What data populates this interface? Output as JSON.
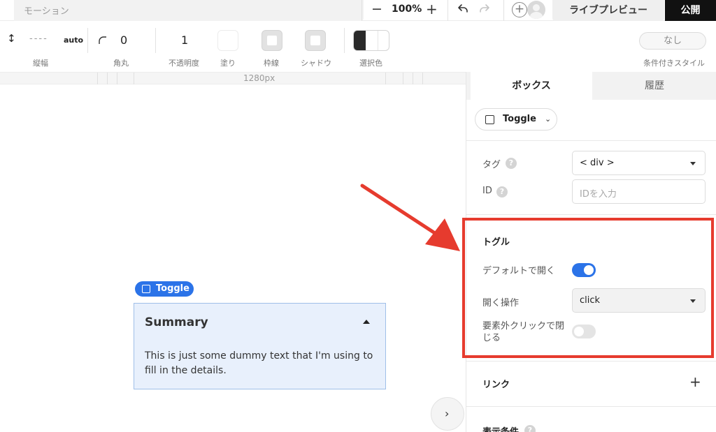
{
  "topbar": {
    "mode_label": "モーション",
    "zoom_minus": "−",
    "zoom_level": "100%",
    "zoom_plus": "+",
    "add_symbol": "+",
    "live_preview_label": "ライブプレビュー",
    "publish_label": "公開"
  },
  "toolbar": {
    "height_icon": "↕",
    "height_value": "----",
    "height_mode": "auto",
    "height_label": "縦幅",
    "radius_value": "0",
    "radius_label": "角丸",
    "opacity_value": "1",
    "opacity_label": "不透明度",
    "fill_label": "塗り",
    "border_label": "枠線",
    "shadow_label": "シャドウ",
    "selection_color_label": "選択色",
    "condition_style_value": "なし",
    "condition_style_label": "条件付きスタイル"
  },
  "ruler": {
    "width_label": "1280px"
  },
  "canvas": {
    "element_badge": "Toggle",
    "toggle_summary": "Summary",
    "toggle_details": "This is just some dummy text that I'm using to fill in the details.",
    "expand_symbol": "›"
  },
  "panel": {
    "tabs": [
      {
        "label": "ボックス",
        "active": true
      },
      {
        "label": "履歴",
        "active": false
      }
    ],
    "element_selector": "Toggle",
    "tag_label": "タグ",
    "tag_value": "< div >",
    "id_label": "ID",
    "id_placeholder": "IDを入力",
    "help_symbol": "?",
    "toggle_section": {
      "title": "トグル",
      "default_open_label": "デフォルトで開く",
      "default_open": true,
      "open_action_label": "開く操作",
      "open_action_value": "click",
      "close_outside_label_line1": "要素外クリックで閉",
      "close_outside_label_line2": "じる",
      "close_outside": false
    },
    "link_label": "リンク",
    "link_add": "+",
    "display_condition_label": "表示条件"
  },
  "colors": {
    "accent": "#2b73e8",
    "annotation": "#e63b2e",
    "publish_bg": "#111111",
    "toggle_box_bg": "#e8f0fc"
  }
}
